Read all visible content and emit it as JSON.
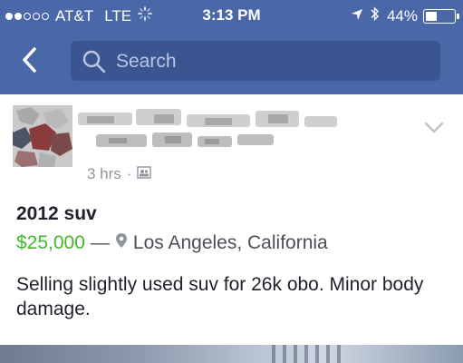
{
  "status_bar": {
    "carrier": "AT&T",
    "network": "LTE",
    "time": "3:13 PM",
    "battery": "44%",
    "battery_level": 0.44,
    "signal_full_dots": 2,
    "signal_total_dots": 5
  },
  "nav": {
    "back_icon": "chevron-left-icon",
    "search_placeholder": "Search",
    "bar_color": "#4a67a8"
  },
  "post": {
    "timestamp": "3 hrs",
    "separator": "·",
    "title": "2012 suv",
    "price": "$25,000",
    "price_color": "#42b72a",
    "dash": "—",
    "location": "Los Angeles, California",
    "description": "Selling slightly used suv for 26k obo. Minor body damage."
  }
}
